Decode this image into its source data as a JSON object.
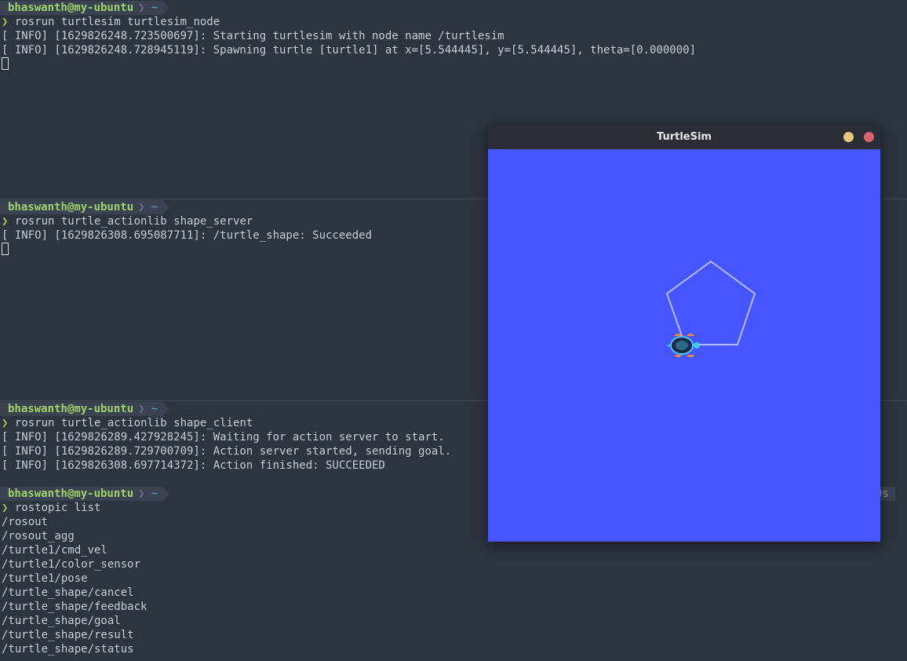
{
  "panes": [
    {
      "user": "bhaswanth@my-ubuntu",
      "dir": "~",
      "command": "rosrun turtlesim turtlesim_node",
      "output": [
        "[ INFO] [1629826248.723500697]: Starting turtlesim with node name /turtlesim",
        "[ INFO] [1629826248.728945119]: Spawning turtle [turtle1] at x=[5.544445], y=[5.544445], theta=[0.000000]"
      ]
    },
    {
      "user": "bhaswanth@my-ubuntu",
      "dir": "~",
      "command": "rosrun turtle_actionlib shape_server",
      "output": [
        "[ INFO] [1629826308.695087711]: /turtle_shape: Succeeded"
      ]
    },
    {
      "user": "bhaswanth@my-ubuntu",
      "dir": "~",
      "command": "rosrun turtle_actionlib shape_client",
      "output": [
        "[ INFO] [1629826289.427928245]: Waiting for action server to start.",
        "[ INFO] [1629826289.729700709]: Action server started, sending goal.",
        "[ INFO] [1629826308.697714372]: Action finished: SUCCEEDED"
      ]
    },
    {
      "user": "bhaswanth@my-ubuntu",
      "dir": "~",
      "command": "rostopic list",
      "right_prompt": "0s",
      "output": [
        "/rosout",
        "/rosout_agg",
        "/turtle1/cmd_vel",
        "/turtle1/color_sensor",
        "/turtle1/pose",
        "/turtle_shape/cancel",
        "/turtle_shape/feedback",
        "/turtle_shape/goal",
        "/turtle_shape/result",
        "/turtle_shape/status"
      ]
    }
  ],
  "prompt_symbol": "❯",
  "turtlesim": {
    "title": "TurtleSim",
    "background_color": "#4556ff",
    "path_color": "#b3bcff"
  },
  "colors": {
    "terminal_bg": "#2e3440",
    "user_green": "#9ed36a",
    "dir_blue": "#4fa8d8"
  }
}
